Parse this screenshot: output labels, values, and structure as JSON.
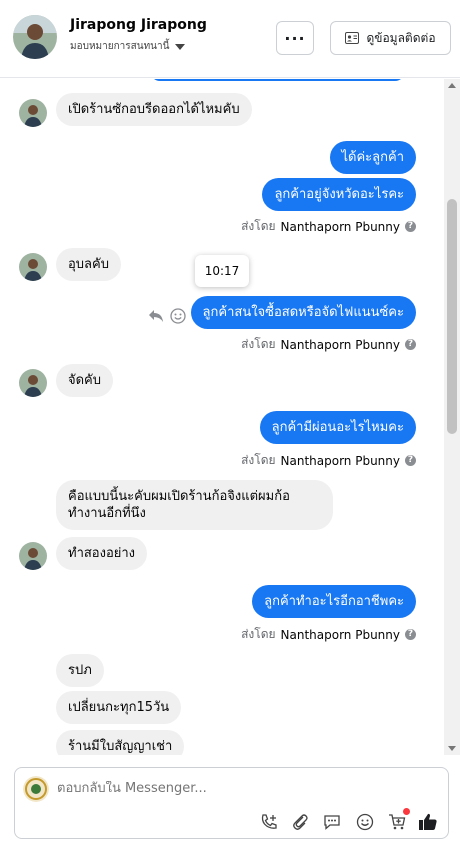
{
  "header": {
    "name": "Jirapong Jirapong",
    "assign_label": "มอบหมายการสนทนานี้",
    "more_label": "···",
    "contact_button": "ดูข้อมูลติดต่อ"
  },
  "messages": [
    {
      "dir": "in",
      "text": "เปิดร้านซักอบรีดออกได้ไหมคับ"
    },
    {
      "dir": "out",
      "text": "ได้ค่ะลูกค้า"
    },
    {
      "dir": "out",
      "text": "ลูกค้าอยู่จังหวัดอะไรคะ"
    },
    {
      "dir": "in",
      "text": "อุบลคับ"
    },
    {
      "dir": "out",
      "text": "ลูกค้าสนใจซื้อสดหรือจัดไฟแนนซ์คะ"
    },
    {
      "dir": "in",
      "text": "จัดคับ"
    },
    {
      "dir": "out",
      "text": "ลูกค้ามีผ่อนอะไรไหมคะ"
    },
    {
      "dir": "in",
      "text": "คือแบบนี้นะคับผมเปิดร้านก้อจิงแต่ผมก้อทำงานอีกที่นึง"
    },
    {
      "dir": "in",
      "text": "ทำสองอย่าง"
    },
    {
      "dir": "out",
      "text": "ลูกค้าทำอะไรอีกอาชีพคะ"
    },
    {
      "dir": "in",
      "text": "รปภ"
    },
    {
      "dir": "in",
      "text": "เปลี่ยนกะทุก15วัน"
    },
    {
      "dir": "in",
      "text": "ร้านมีใบสัญญาเช่า"
    }
  ],
  "sent_by": {
    "prefix": "ส่งโดย",
    "agent": "Nanthaporn Pbunny"
  },
  "tooltip_time": "10:17",
  "composer": {
    "placeholder": "ตอบกลับใน Messenger..."
  },
  "colors": {
    "outgoing": "#1877f2",
    "incoming": "#f0f0f0",
    "accent_red": "#fa383e"
  },
  "icons": [
    "more-icon",
    "contact-card-icon",
    "reply-icon",
    "emoji-icon",
    "call-icon",
    "attach-icon",
    "saved-reply-icon",
    "cart-icon",
    "like-icon"
  ]
}
